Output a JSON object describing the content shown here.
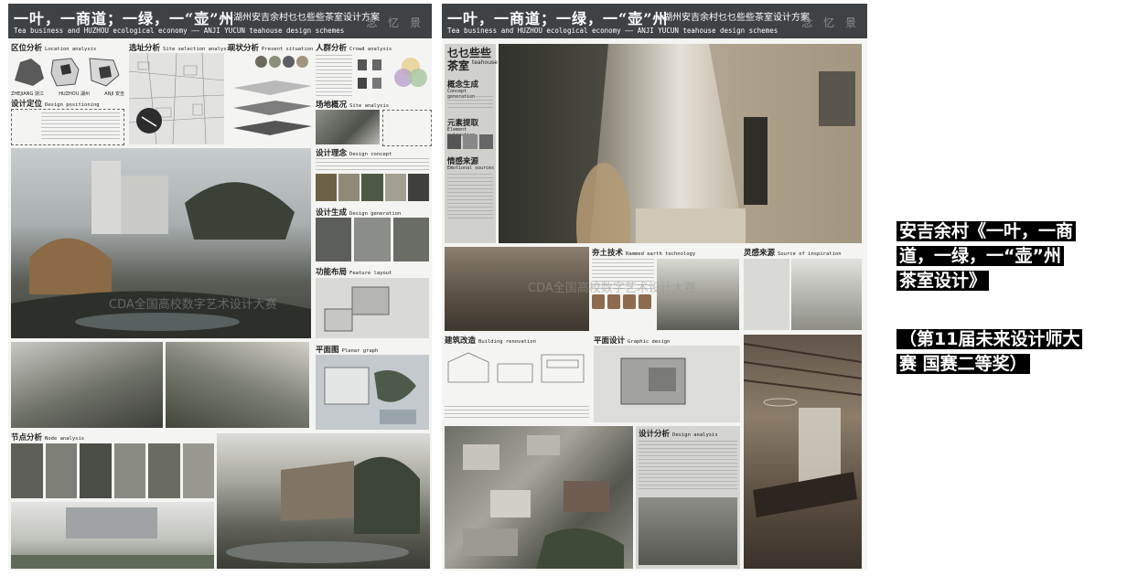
{
  "banner": {
    "title_cn": "一叶，一商道；一绿，一“壶”州",
    "subtitle_cn": "—湖州安吉余村乜乜些些茶室设计方案",
    "subtitle_cn_right": "湖州安吉余村乜乜些些茶室设计方案",
    "title_en": "Tea business and HUZHOU ecological economy —— ANJI YUCUN teahouse design schemes",
    "watermark": "念 忆 景"
  },
  "board1": {
    "sections": {
      "location": {
        "cn": "区位分析",
        "en": "Location analysis"
      },
      "site_selection": {
        "cn": "选址分析",
        "en": "Site selection analysis"
      },
      "present": {
        "cn": "现状分析",
        "en": "Present situation"
      },
      "crowd": {
        "cn": "人群分析",
        "en": "Crowd analysis"
      },
      "positioning": {
        "cn": "设计定位",
        "en": "Design positioning"
      },
      "site_overview": {
        "cn": "场地概况",
        "en": "Site analysis"
      },
      "concept": {
        "cn": "设计理念",
        "en": "Design concept"
      },
      "generation": {
        "cn": "设计生成",
        "en": "Design generation"
      },
      "feature": {
        "cn": "功能布局",
        "en": "Feature layout"
      },
      "plan": {
        "cn": "平面图",
        "en": "Planar graph"
      },
      "node": {
        "cn": "节点分析",
        "en": "Node analysis"
      }
    },
    "map_labels": [
      "ZHEJIANG 浙江",
      "HUZHOU 湖州",
      "ANJI 安吉"
    ]
  },
  "board2": {
    "brand_title": "乜乜些些茶室",
    "brand_en": "teahouse",
    "sections": {
      "concept_gen": {
        "cn": "概念生成",
        "en": "Concept generation"
      },
      "element": {
        "cn": "元素提取",
        "en": "Element extraction"
      },
      "emotion": {
        "cn": "情感来源",
        "en": "Emotional sources"
      },
      "rammed": {
        "cn": "夯土技术",
        "en": "Rammed earth technology"
      },
      "inspiration": {
        "cn": "灵感来源",
        "en": "Source of inspiration"
      },
      "renovation": {
        "cn": "建筑改造",
        "en": "Building renovation"
      },
      "graphic": {
        "cn": "平面设计",
        "en": "Graphic design"
      },
      "analysis": {
        "cn": "设计分析",
        "en": "Design analysis"
      }
    }
  },
  "watermark_overlay": "CDA全国高校数字艺术设计大赛",
  "caption": {
    "line1": "安吉余村《一叶，一商",
    "line2": "道，一绿，一“壶”州",
    "line3": "茶室设计》",
    "award1": "（第11届未来设计师大",
    "award2": "赛 国赛二等奖）"
  }
}
